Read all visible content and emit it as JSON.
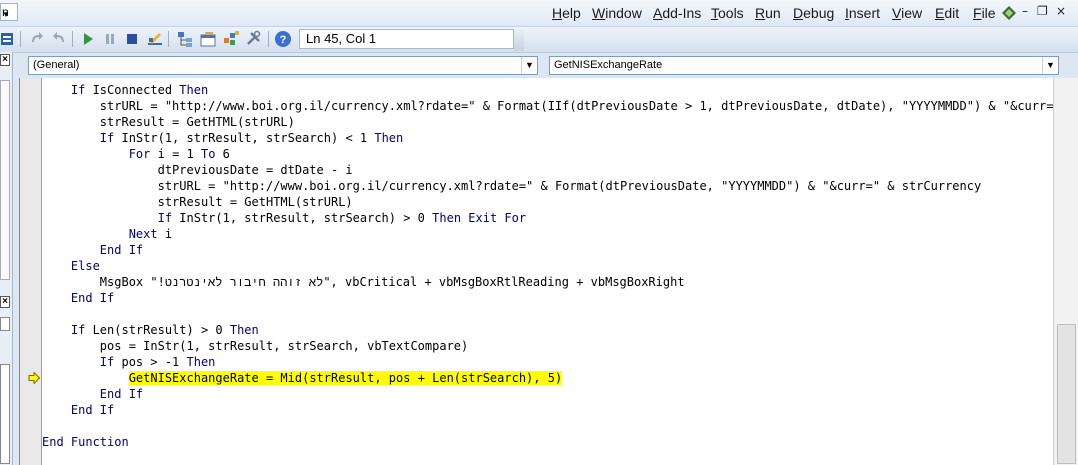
{
  "menubar": {
    "left_stub_text": "n",
    "items": [
      {
        "label": "Help",
        "ul": "H",
        "rest": "elp"
      },
      {
        "label": "Window",
        "ul": "W",
        "rest": "indow"
      },
      {
        "label": "Add-Ins",
        "ul": "A",
        "rest": "dd-Ins"
      },
      {
        "label": "Tools",
        "ul": "T",
        "rest": "ools"
      },
      {
        "label": "Run",
        "ul": "R",
        "rest": "un"
      },
      {
        "label": "Debug",
        "ul": "D",
        "rest": "ebug"
      },
      {
        "label": "Insert",
        "ul": "I",
        "rest": "nsert"
      },
      {
        "label": "View",
        "ul": "V",
        "rest": "iew"
      },
      {
        "label": "Edit",
        "ul": "E",
        "rest": "dit"
      },
      {
        "label": "File",
        "ul": "F",
        "rest": "ile"
      }
    ],
    "window_controls": {
      "minimize": "–",
      "restore": "❐",
      "close": "×"
    }
  },
  "toolbar": {
    "status": "Ln 45, Col 1",
    "icons": [
      "redo-icon",
      "undo-icon",
      "run-icon",
      "break-icon",
      "reset-icon",
      "design-mode-icon",
      "project-explorer-icon",
      "properties-icon",
      "object-browser-icon",
      "toolbox-icon",
      "help-icon"
    ]
  },
  "left_panel": {
    "close1": "×",
    "close2": "×"
  },
  "combos": {
    "object": "(General)",
    "procedure": "GetNISExchangeRate"
  },
  "colors": {
    "keyword": "#00007f",
    "highlight": "#ffff00",
    "exec_arrow": "#ffff00"
  },
  "code": [
    {
      "indent": "    ",
      "segments": [
        {
          "t": "If",
          "k": true
        },
        {
          "t": " IsConnected ",
          "k": false
        },
        {
          "t": "Then",
          "k": true
        }
      ]
    },
    {
      "indent": "        ",
      "segments": [
        {
          "t": "strURL = \"http://www.boi.org.il/currency.xml?rdate=\" & Format(IIf(dtPreviousDate > 1, dtPreviousDate, dtDate), \"YYYYMMDD\") & \"&curr=\" & strCurrency",
          "k": false
        }
      ]
    },
    {
      "indent": "        ",
      "segments": [
        {
          "t": "strResult = GetHTML(strURL)",
          "k": false
        }
      ]
    },
    {
      "indent": "        ",
      "segments": [
        {
          "t": "If",
          "k": true
        },
        {
          "t": " InStr(1, strResult, strSearch) < 1 ",
          "k": false
        },
        {
          "t": "Then",
          "k": true
        }
      ]
    },
    {
      "indent": "            ",
      "segments": [
        {
          "t": "For",
          "k": true
        },
        {
          "t": " i = 1 ",
          "k": false
        },
        {
          "t": "To",
          "k": true
        },
        {
          "t": " 6",
          "k": false
        }
      ]
    },
    {
      "indent": "                ",
      "segments": [
        {
          "t": "dtPreviousDate = dtDate - i",
          "k": false
        }
      ]
    },
    {
      "indent": "                ",
      "segments": [
        {
          "t": "strURL = \"http://www.boi.org.il/currency.xml?rdate=\" & Format(dtPreviousDate, \"YYYYMMDD\") & \"&curr=\" & strCurrency",
          "k": false
        }
      ]
    },
    {
      "indent": "                ",
      "segments": [
        {
          "t": "strResult = GetHTML(strURL)",
          "k": false
        }
      ]
    },
    {
      "indent": "                ",
      "segments": [
        {
          "t": "If",
          "k": true
        },
        {
          "t": " InStr(1, strResult, strSearch) > 0 ",
          "k": false
        },
        {
          "t": "Then Exit For",
          "k": true
        }
      ]
    },
    {
      "indent": "            ",
      "segments": [
        {
          "t": "Next",
          "k": true
        },
        {
          "t": " i",
          "k": false
        }
      ]
    },
    {
      "indent": "        ",
      "segments": [
        {
          "t": "End If",
          "k": true
        }
      ]
    },
    {
      "indent": "    ",
      "segments": [
        {
          "t": "Else",
          "k": true
        }
      ]
    },
    {
      "indent": "        ",
      "segments": [
        {
          "t": "MsgBox \"!לא זוהה חיבור לאינטרנט\", vbCritical + vbMsgBoxRtlReading + vbMsgBoxRight",
          "k": false
        }
      ]
    },
    {
      "indent": "    ",
      "segments": [
        {
          "t": "End If",
          "k": true
        }
      ]
    },
    {
      "indent": "",
      "segments": []
    },
    {
      "indent": "    ",
      "segments": [
        {
          "t": "If",
          "k": true
        },
        {
          "t": " Len(strResult) > 0 ",
          "k": false
        },
        {
          "t": "Then",
          "k": true
        }
      ]
    },
    {
      "indent": "        ",
      "segments": [
        {
          "t": "pos = InStr(1, strResult, strSearch, vbTextCompare)",
          "k": false
        }
      ]
    },
    {
      "indent": "        ",
      "segments": [
        {
          "t": "If",
          "k": true
        },
        {
          "t": " pos > -1 ",
          "k": false
        },
        {
          "t": "Then",
          "k": true
        }
      ]
    },
    {
      "indent": "            ",
      "highlight": true,
      "segments": [
        {
          "t": "GetNISExchangeRate = Mid(strResult, pos + Len(strSearch), 5)",
          "k": false
        }
      ]
    },
    {
      "indent": "        ",
      "segments": [
        {
          "t": "End If",
          "k": true
        }
      ]
    },
    {
      "indent": "    ",
      "segments": [
        {
          "t": "End If",
          "k": true
        }
      ]
    },
    {
      "indent": "",
      "segments": []
    },
    {
      "indent": "",
      "segments": [
        {
          "t": "End Function",
          "k": true
        }
      ]
    }
  ]
}
